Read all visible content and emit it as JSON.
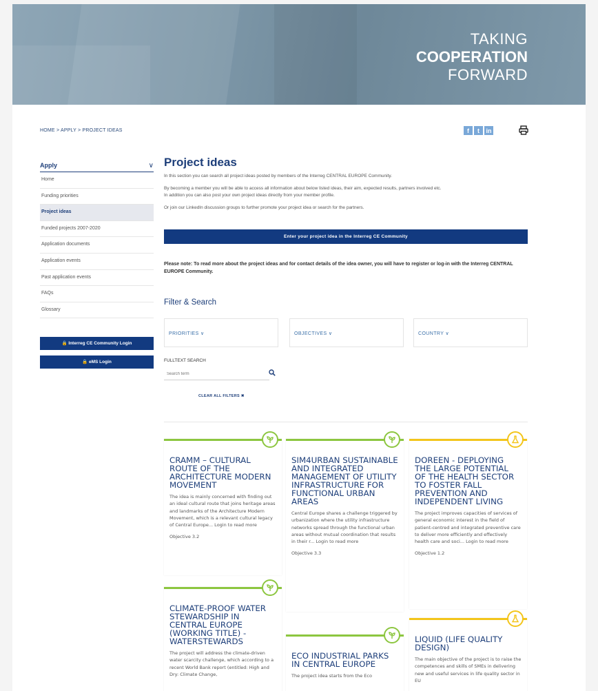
{
  "hero": {
    "line1": "TAKING",
    "line2": "COOPERATION",
    "line3": "FORWARD"
  },
  "breadcrumb": "HOME > APPLY > PROJECT IDEAS",
  "social": {
    "facebook": "f",
    "twitter": "t",
    "linkedin": "in"
  },
  "sidebar": {
    "heading": "Apply",
    "items": [
      {
        "label": "Home"
      },
      {
        "label": "Funding priorities"
      },
      {
        "label": "Project ideas"
      },
      {
        "label": "Funded projects 2007-2020"
      },
      {
        "label": "Application documents"
      },
      {
        "label": "Application events"
      },
      {
        "label": "Past application events"
      },
      {
        "label": "FAQs"
      },
      {
        "label": "Glossary"
      }
    ],
    "login_community": "🔒 Interreg CE Community Login",
    "login_ems": "🔒 eMS Login"
  },
  "main": {
    "title": "Project ideas",
    "intro": "In this section you can search all project ideas posted by members of the Interreg CENTRAL EUROPE Community.",
    "member_text1": "By becoming a member you will be able to access all information about below listed ideas, their aim, expected results, partners involved etc.",
    "member_text2": "In addition you can also post your own project ideas directly from your member profile.",
    "linkedin_text": "Or join our LinkedIn discussion groups to further promote your project idea or search for the partners.",
    "cta": "Enter your project idea in the Interreg CE Community",
    "note_bold1": "Please note: To read more about the project ideas and for contact details of the idea owner, you will have to register or log-in with",
    "note_bold2": "the Interreg CENTRAL EUROPE Community",
    "note_end": "."
  },
  "filters": {
    "title": "Filter & Search",
    "priorities": "PRIORITIES ∨",
    "objectives": "OBJECTIVES ∨",
    "country": "COUNTRY ∨",
    "fulltext_label": "FULLTEXT SEARCH",
    "search_placeholder": "Search term",
    "clear": "CLEAR ALL FILTERS ✖"
  },
  "cards": [
    {
      "title": "CRAMM – CULTURAL ROUTE OF THE ARCHITECTURE MODERN MOVEMENT",
      "desc": "The idea is mainly concerned with finding out an ideal cultural route that joins heritage areas and landmarks of the Architecture Modern Movement, which is a relevant cultural legacy of Central Europe... Login to read more",
      "objective": "Objective 3.2",
      "color": "#8cc63f",
      "icon": "plant-icon"
    },
    {
      "title": "SIM4URBAN SUSTAINABLE AND INTEGRATED MANAGEMENT OF UTILITY INFRASTRUCTURE FOR FUNCTIONAL URBAN AREAS",
      "desc": "Central Europe shares a challenge triggered by urbanization where the utility infrastructure networks spread through the functional urban areas without mutual coordination that results in their r... Login to read more",
      "objective": "Objective 3.3",
      "color": "#8cc63f",
      "icon": "plant-icon"
    },
    {
      "title": "DOREEN - DEPLOYING THE LARGE POTENTIAL OF THE HEALTH SECTOR TO FOSTER FALL PREVENTION AND INDEPENDENT LIVING",
      "desc": "The project improves capacities of services of general economic interest in the field of patient-centred and integrated preventive care to deliver more efficiently and effectively health care and soci... Login to read more",
      "objective": "Objective 1.2",
      "color": "#f3c51a",
      "icon": "lab-flask-icon"
    },
    {
      "title": "CLIMATE-PROOF WATER STEWARDSHIP IN CENTRAL EUROPE (WORKING TITLE) - WATERSTEWARDS",
      "desc": "The project will address the climate-driven water scarcity challenge, which according to a recent World Bank report (entitled: High and Dry: Climate Change,",
      "objective": "",
      "color": "#8cc63f",
      "icon": "plant-icon"
    },
    {
      "title": "ECO INDUSTRIAL PARKS IN CENTRAL EUROPE",
      "desc": "The project idea starts from the Eco",
      "objective": "",
      "color": "#8cc63f",
      "icon": "plant-icon"
    },
    {
      "title": "LIQUID (LIFE QUALITY DESIGN)",
      "desc": "The main objective of the project is to raise the competences and skills of SMEs in delivering new and useful services in life quality sector in EU",
      "objective": "",
      "color": "#f3c51a",
      "icon": "lab-flask-icon"
    }
  ]
}
